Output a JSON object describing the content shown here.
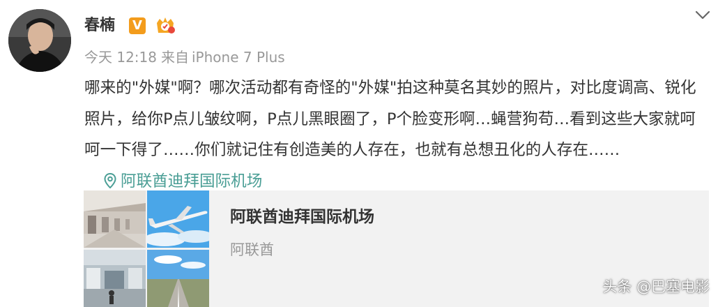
{
  "post": {
    "author": "春楠",
    "time": "今天 12:18",
    "source_prefix": "来自",
    "device": "iPhone 7 Plus",
    "text": "哪来的\"外媒\"啊？哪次活动都有奇怪的\"外媒\"拍这种莫名其妙的照片，对比度调高、锐化照片，给你P点儿皱纹啊，P点儿黑眼圈了，P个脸变形啊…蝇营狗苟…看到这些大家就呵呵一下得了……你们就记住有创造美的人存在，也就有总想丑化的人存在……",
    "location": "阿联酋迪拜国际机场"
  },
  "card": {
    "title": "阿联酋迪拜国际机场",
    "subtitle": "阿联酋"
  },
  "watermark": "头条 @巴塞电影",
  "icons": {
    "verified": "verified-v-icon",
    "member": "member-badge-icon",
    "location": "location-pin-icon",
    "chevron": "chevron-down-icon"
  },
  "colors": {
    "location": "#4a9e95",
    "verified": "#f39c1c",
    "meta": "#999999"
  }
}
